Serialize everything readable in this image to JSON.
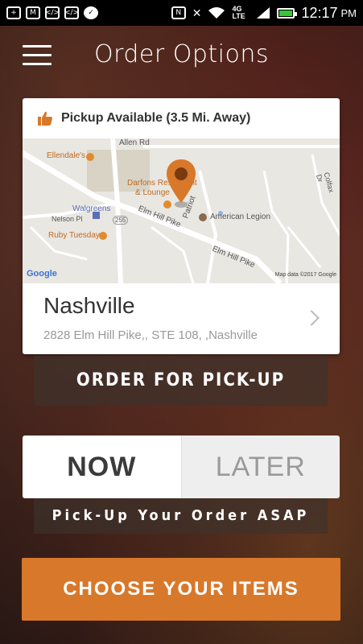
{
  "status_bar": {
    "time": "12:17",
    "ampm": "PM",
    "network": "4G LTE",
    "battery_level": 0.9,
    "icons": [
      "plus-icon",
      "mail-icon",
      "code-icon",
      "code-icon",
      "check-icon",
      "nfc-icon",
      "mute-icon",
      "wifi-icon",
      "signal-icon",
      "battery-icon"
    ]
  },
  "header": {
    "title": "Order Options",
    "menu_icon": "hamburger-menu-icon"
  },
  "card": {
    "pickup_label": "Pickup Available (3.5 Mi. Away)",
    "pickup_icon": "thumbs-up-icon",
    "map": {
      "labels": {
        "allen_rd": "Allen Rd",
        "ellendales": "Ellendale's",
        "darfons": "Darfons Restaurant",
        "lounge": "& Lounge",
        "walgreens": "Walgreens",
        "nelson": "Nelson Pl",
        "route": "255",
        "elm_hill_pike": "Elm Hill Pike",
        "elm_hill_pike2": "Elm Hill Pike",
        "ruby_tuesday": "Ruby Tuesday",
        "patriot": "Patriot",
        "american_legion": "American Legion",
        "colfax": "Colfax Dr",
        "google": "Google",
        "map_data": "Map data ©2017 Google"
      }
    },
    "store_name": "Nashville",
    "store_address": "2828 Elm Hill Pike,, STE 108, ,Nashville"
  },
  "order_pickup_label": "ORDER FOR PICK-UP",
  "timing": {
    "now": "NOW",
    "later": "LATER",
    "selected": "NOW"
  },
  "asap_label": "Pick-Up Your Order ASAP",
  "choose_items_label": "CHOOSE YOUR ITEMS",
  "colors": {
    "accent": "#d8782a",
    "pin": "#d8782a"
  }
}
